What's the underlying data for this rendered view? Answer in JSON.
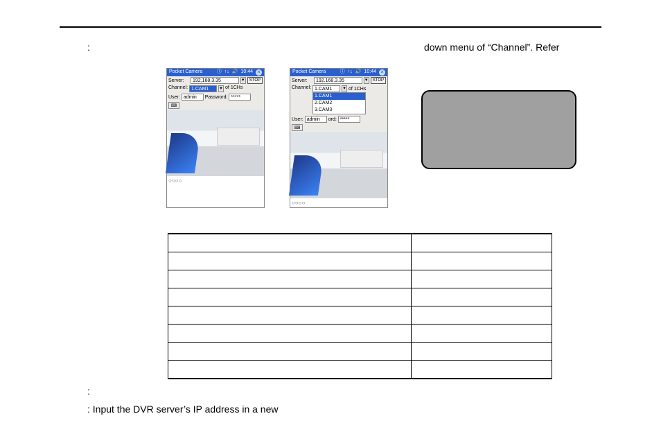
{
  "text_colon1": ":",
  "text_right": "down menu of “Channel”. Refer",
  "text_bottom1": ":",
  "text_bottom2": ": Input the DVR server’s IP address in a new",
  "pda": {
    "title": "Pocket Camera",
    "time": "10:44",
    "close": "✕",
    "icons": {
      "bt": "ⓘ",
      "wifi": "⤳",
      "sig": "↑↓",
      "vol": "🔊"
    },
    "server_label": "Server:",
    "server_value": "192.168.3.35",
    "tri": "▼",
    "stop": "STOP",
    "channel_label": "Channel:",
    "channel_selected": "1.CAM1",
    "channel_suffix_closed": "of 1CHs",
    "channel_suffix_open": "of 1CHs",
    "channel_options": [
      "1.CAM1",
      "2.CAM2",
      "3.CAM3"
    ],
    "user_label": "User:",
    "user_value": "admin",
    "password_label_closed": "Password:",
    "password_label_open": "ord:",
    "password_value": "*****",
    "kb": "⌨",
    "dots": "○○○○"
  },
  "table": {
    "rows": 8
  }
}
